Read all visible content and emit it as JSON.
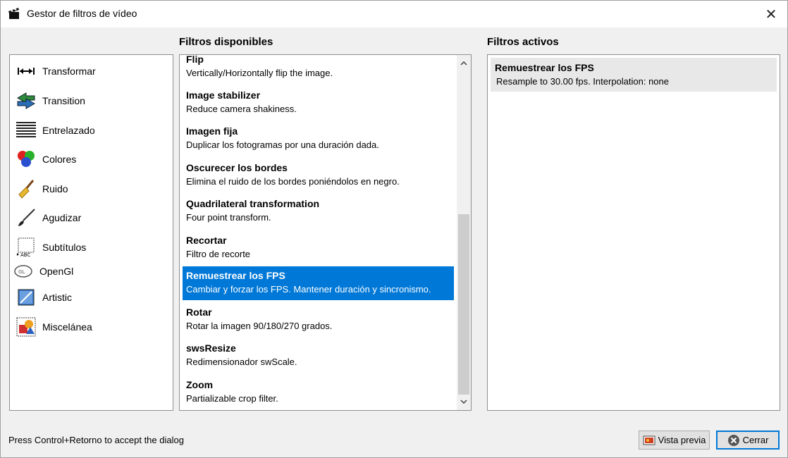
{
  "window": {
    "title": "Gestor de filtros de vídeo",
    "close_glyph": "✕"
  },
  "headers": {
    "available": "Filtros disponibles",
    "active": "Filtros activos"
  },
  "categories": [
    {
      "label": "Transformar",
      "icon": "transform-icon"
    },
    {
      "label": "Transition",
      "icon": "transition-icon"
    },
    {
      "label": "Entrelazado",
      "icon": "interlace-icon"
    },
    {
      "label": "Colores",
      "icon": "colors-icon"
    },
    {
      "label": "Ruido",
      "icon": "broom-icon"
    },
    {
      "label": "Agudizar",
      "icon": "brush-icon"
    },
    {
      "label": "Subtítulos",
      "icon": "subtitles-icon"
    },
    {
      "label": "OpenGl",
      "icon": "opengl-icon"
    },
    {
      "label": "Artistic",
      "icon": "artistic-icon"
    },
    {
      "label": "Miscelánea",
      "icon": "misc-icon"
    }
  ],
  "filters": [
    {
      "name": "Flip",
      "desc": "Vertically/Horizontally flip the image."
    },
    {
      "name": "Image stabilizer",
      "desc": "Reduce camera shakiness."
    },
    {
      "name": "Imagen fija",
      "desc": "Duplicar los fotogramas por una duración dada."
    },
    {
      "name": "Oscurecer los bordes",
      "desc": "Elimina el ruido de los bordes poniéndolos en negro."
    },
    {
      "name": "Quadrilateral transformation",
      "desc": "Four point transform."
    },
    {
      "name": "Recortar",
      "desc": "Filtro de recorte"
    },
    {
      "name": "Remuestrear los FPS",
      "desc": "Cambiar y forzar los FPS. Mantener duración y sincronismo.",
      "selected": true
    },
    {
      "name": "Rotar",
      "desc": "Rotar la imagen 90/180/270 grados."
    },
    {
      "name": "swsResize",
      "desc": "Redimensionador swScale."
    },
    {
      "name": "Zoom",
      "desc": "Partializable crop filter."
    }
  ],
  "active_filters": [
    {
      "name": "Remuestrear los FPS",
      "desc": "Resample to 30.00 fps. Interpolation: none"
    }
  ],
  "footer": {
    "hint": "Press Control+Retorno to accept the dialog",
    "preview_label": "Vista previa",
    "close_label": "Cerrar"
  },
  "colors": {
    "selection": "#0078d7",
    "active_item_bg": "#e8e8e8"
  }
}
